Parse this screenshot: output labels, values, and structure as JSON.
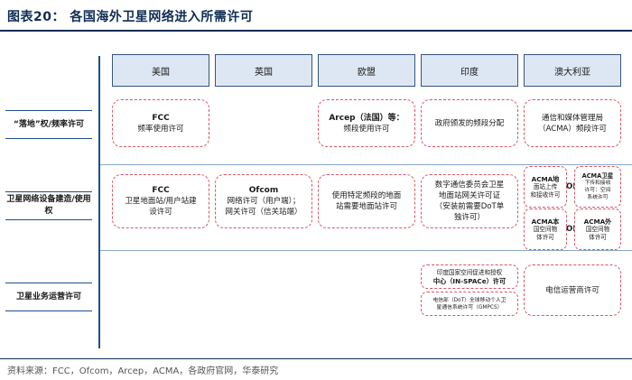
{
  "title": "图表20：  各国海外卫星网络进入所需许可",
  "columns": [
    "美国",
    "英国",
    "欧盟",
    "印度",
    "澳大利亚"
  ],
  "rows": [
    {
      "label": "“落地”权/频率许可"
    },
    {
      "label": "卫星网络设备建造/使用权"
    },
    {
      "label": "卫星业务运营许可"
    }
  ],
  "cells": {
    "us_landing": [
      "FCC",
      "频率使用许可"
    ],
    "eu_landing": [
      "Arcep（法国）等：",
      "频段使用许可"
    ],
    "in_landing": [
      "政府颁发的频段分配"
    ],
    "au_landing": [
      "通信和媒体管理局",
      "（ACMA）频段许可"
    ],
    "us_equipment": [
      "FCC",
      "卫星地面站/用户站建",
      "设许可"
    ],
    "uk_equipment": [
      "Ofcom",
      "网络许可（用户端）；",
      "网关许可（信关站端）"
    ],
    "eu_equipment": [
      "使用特定频段的地面",
      "站需要地面站许可"
    ],
    "in_equipment": [
      "数字通信委员会卫星",
      "地面站网关许可证",
      "（安装前需要DoT单",
      "独许可）"
    ],
    "au_equipment_1": [
      "ACMA地",
      "面站上传",
      "和接收许可"
    ],
    "au_equipment_2": [
      "ACMA卫星",
      "下传和接收",
      "许可：空间",
      "系统许可"
    ],
    "au_equipment_3": [
      "ACMA本",
      "国空间物",
      "体许可"
    ],
    "au_equipment_4": [
      "ACMA外",
      "国空间物",
      "体许可"
    ],
    "in_ops_1": [
      "印度国家空间促进和授权",
      "中心（IN-SPACe）许可"
    ],
    "in_ops_2": [
      "电信部（DoT）全球移动个人卫",
      "星通信系统许可（GMPCS）"
    ],
    "au_ops": [
      "电信运营商许可"
    ]
  },
  "or_label": "or",
  "source": "资料来源：FCC，Ofcom，Arcep，ACMA，各政府官网，华泰研究",
  "colors": {
    "title": "#0f2d55",
    "header_fill": "#dde7f3",
    "header_border": "#35567e",
    "dashed_border": "#d6566a",
    "axis": "#1f4e8a"
  }
}
